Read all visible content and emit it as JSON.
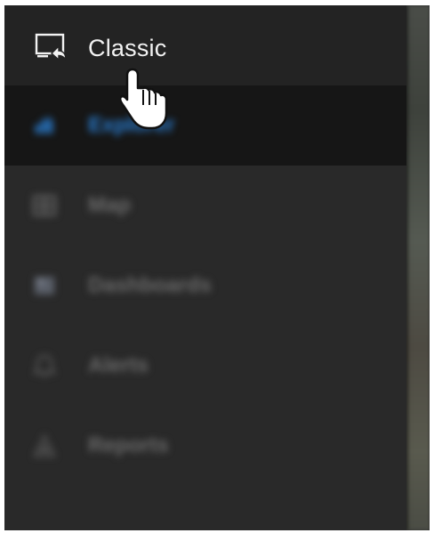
{
  "menu": {
    "classic_label": "Classic",
    "items": [
      {
        "label": "Explorer",
        "icon": "explorer-icon",
        "active": true
      },
      {
        "label": "Map",
        "icon": "map-icon",
        "active": false
      },
      {
        "label": "Dashboards",
        "icon": "dashboard-icon",
        "active": false
      },
      {
        "label": "Alerts",
        "icon": "alerts-icon",
        "active": false
      },
      {
        "label": "Reports",
        "icon": "reports-icon",
        "active": false
      }
    ]
  },
  "colors": {
    "panel_bg": "#292929",
    "header_bg": "#232323",
    "active_bg": "#161616",
    "active_text": "#2a7fd4",
    "muted_text": "#6a6a6a",
    "label_text": "#f2f2f2"
  },
  "cursor": "hand-pointer-icon"
}
